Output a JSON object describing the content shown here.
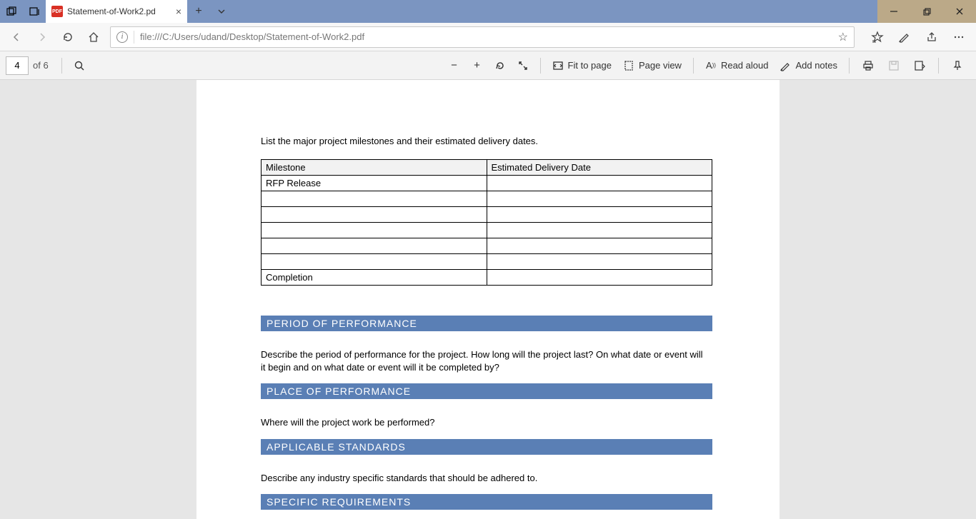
{
  "titlebar": {
    "tab_title": "Statement-of-Work2.pd"
  },
  "addressbar": {
    "url": "file:///C:/Users/udand/Desktop/Statement-of-Work2.pdf"
  },
  "pdfbar": {
    "page_current": "4",
    "page_total": "of 6",
    "fit_to_page": "Fit to page",
    "page_view": "Page view",
    "read_aloud": "Read aloud",
    "add_notes": "Add notes"
  },
  "document": {
    "intro": "List the major project milestones and their estimated delivery dates.",
    "table": {
      "headers": [
        "Milestone",
        "Estimated Delivery Date"
      ],
      "rows": [
        [
          "RFP Release",
          ""
        ],
        [
          "",
          ""
        ],
        [
          "",
          ""
        ],
        [
          "",
          ""
        ],
        [
          "",
          ""
        ],
        [
          "",
          ""
        ],
        [
          "Completion",
          ""
        ]
      ]
    },
    "sections": [
      {
        "title": "PERIOD OF PERFORMANCE",
        "body": "Describe the period of performance for the project. How long will the project last? On what date or event will it begin and on what date or event will it be completed by?"
      },
      {
        "title": "PLACE OF PERFORMANCE",
        "body": "Where will the project work be performed?"
      },
      {
        "title": "APPLICABLE STANDARDS",
        "body": "Describe any industry specific standards that should be adhered to."
      },
      {
        "title": "SPECIFIC REQUIREMENTS",
        "body": ""
      }
    ]
  }
}
